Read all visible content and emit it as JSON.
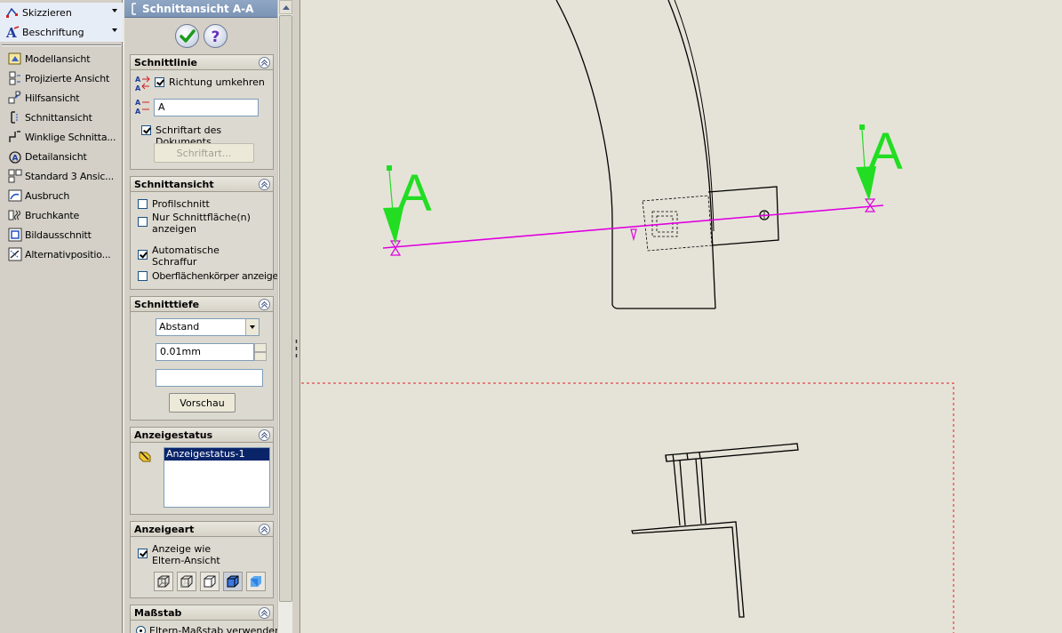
{
  "toolbar": {
    "top": [
      {
        "label": "Skizzieren",
        "icon": "sketch-icon"
      },
      {
        "label": "Beschriftung",
        "icon": "annotation-icon"
      }
    ],
    "items": [
      {
        "label": "Modellansicht",
        "icon": "model-view-icon"
      },
      {
        "label": "Projizierte Ansicht",
        "icon": "projected-view-icon"
      },
      {
        "label": "Hilfsansicht",
        "icon": "auxiliary-view-icon"
      },
      {
        "label": "Schnittansicht",
        "icon": "section-view-icon"
      },
      {
        "label": "Winklige Schnitta...",
        "icon": "aligned-section-icon"
      },
      {
        "label": "Detailansicht",
        "icon": "detail-view-icon"
      },
      {
        "label": "Standard 3 Ansic...",
        "icon": "standard-3-view-icon"
      },
      {
        "label": "Ausbruch",
        "icon": "broken-out-section-icon"
      },
      {
        "label": "Bruchkante",
        "icon": "break-line-icon"
      },
      {
        "label": "Bildausschnitt",
        "icon": "crop-view-icon"
      },
      {
        "label": "Alternativpositio...",
        "icon": "alternate-position-icon"
      }
    ]
  },
  "pm": {
    "title": "Schnittansicht A-A",
    "schnittlinie": {
      "header": "Schnittlinie",
      "richtung_label": "Richtung umkehren",
      "richtung_checked": true,
      "label_value": "A",
      "schriftart_doc_label": "Schriftart des Dokuments",
      "schriftart_doc_checked": true,
      "schriftart_btn": "Schriftart..."
    },
    "schnittansicht": {
      "header": "Schnittansicht",
      "profil_label": "Profilschnitt",
      "nur_line1": "Nur Schnittfläche(n)",
      "nur_line2": "anzeigen",
      "auto_line1": "Automatische",
      "auto_line2": "Schraffur",
      "ober_label": "Oberflächenkörper anzeigen"
    },
    "schnitttiefe": {
      "header": "Schnitttiefe",
      "select_value": "Abstand",
      "depth_value": "0.01mm",
      "vorschau_btn": "Vorschau"
    },
    "anzeigestatus": {
      "header": "Anzeigestatus",
      "selected": "Anzeigestatus-1"
    },
    "anzeigeart": {
      "header": "Anzeigeart",
      "line1": "Anzeige wie",
      "line2": "Eltern-Ansicht"
    },
    "massstab": {
      "header": "Maßstab",
      "option": "Eltern-Maßstab verwenden"
    }
  },
  "drawing": {
    "section_label_left": "A",
    "section_label_right": "A",
    "section_line_color": "#E000E0",
    "arrow_color": "#22DD22",
    "border_color": "#E02020"
  }
}
